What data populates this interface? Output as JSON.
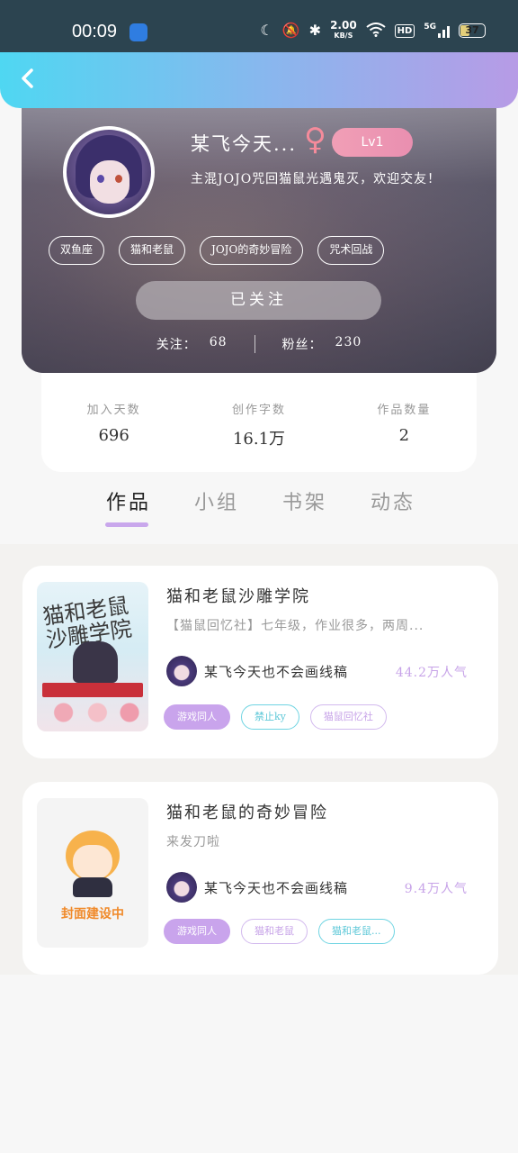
{
  "status_bar": {
    "time": "00:09",
    "net_speed_value": "2.00",
    "net_speed_unit": "KB/S",
    "hd_label": "HD",
    "network": "5G",
    "battery": "37",
    "battery_level_percent": 37
  },
  "profile": {
    "username": "某飞今天...",
    "gender_symbol": "♀",
    "level": "Lv1",
    "bio": "主混JOJO咒回猫鼠光遇鬼灭，欢迎交友！",
    "tags": [
      "双鱼座",
      "猫和老鼠",
      "JOJO的奇妙冒险",
      "咒术回战"
    ],
    "follow_button": "已关注",
    "following_label": "关注：",
    "following_count": "68",
    "fans_label": "粉丝：",
    "fans_count": "230"
  },
  "stats": [
    {
      "label": "加入天数",
      "value": "696"
    },
    {
      "label": "创作字数",
      "value": "16.1万"
    },
    {
      "label": "作品数量",
      "value": "2"
    }
  ],
  "tabs": [
    "作品",
    "小组",
    "书架",
    "动态"
  ],
  "works": [
    {
      "title": "猫和老鼠沙雕学院",
      "desc": "【猫鼠回忆社】七年级，作业很多，两周...",
      "author": "某飞今天也不会画线稿",
      "popularity": "44.2万人气",
      "cover_text": "猫和老鼠沙雕学院",
      "tags": [
        "游戏同人",
        "禁止ky",
        "猫鼠回忆社"
      ]
    },
    {
      "title": "猫和老鼠的奇妙冒险",
      "desc": "来发刀啦",
      "author": "某飞今天也不会画线稿",
      "popularity": "9.4万人气",
      "cover_text": "封面建设中",
      "tags": [
        "游戏同人",
        "猫和老鼠",
        "猫和老鼠..."
      ]
    }
  ]
}
